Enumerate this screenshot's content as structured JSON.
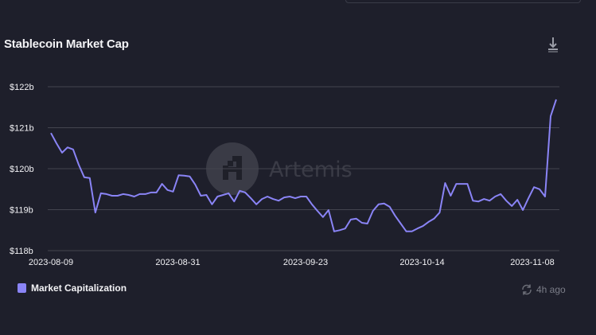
{
  "header": {
    "title": "Stablecoin Market Cap",
    "download_icon": "download-icon"
  },
  "watermark": {
    "text": "Artemis"
  },
  "footer": {
    "updated": "4h ago",
    "refresh_icon": "refresh-icon"
  },
  "colors": {
    "line": "#8a84f6",
    "grid": "#44454f",
    "background": "#1e1f2b"
  },
  "chart_data": {
    "type": "line",
    "title": "Stablecoin Market Cap",
    "xlabel": "",
    "ylabel": "",
    "ylim": [
      118,
      122
    ],
    "yticks": [
      {
        "v": 122,
        "label": "$122b"
      },
      {
        "v": 121,
        "label": "$121b"
      },
      {
        "v": 120,
        "label": "$120b"
      },
      {
        "v": 119,
        "label": "$119b"
      },
      {
        "v": 118,
        "label": "$118b"
      }
    ],
    "x_start": "2023-08-09",
    "x_end": "2023-11-10",
    "xticks": [
      {
        "i": 0,
        "label": "2023-08-09"
      },
      {
        "i": 22,
        "label": "2023-08-31"
      },
      {
        "i": 45,
        "label": "2023-09-23"
      },
      {
        "i": 66,
        "label": "2023-10-14"
      },
      {
        "i": 91,
        "label": "2023-11-08"
      }
    ],
    "grid": true,
    "legend_position": "bottom-left",
    "series": [
      {
        "name": "Market Capitalization",
        "color": "#8a84f6",
        "values": [
          120.87,
          120.62,
          120.39,
          120.52,
          120.47,
          120.1,
          119.79,
          119.77,
          118.93,
          119.4,
          119.38,
          119.34,
          119.34,
          119.38,
          119.36,
          119.32,
          119.38,
          119.38,
          119.42,
          119.42,
          119.63,
          119.48,
          119.44,
          119.84,
          119.83,
          119.81,
          119.61,
          119.34,
          119.36,
          119.13,
          119.32,
          119.36,
          119.4,
          119.2,
          119.46,
          119.42,
          119.28,
          119.13,
          119.26,
          119.32,
          119.26,
          119.22,
          119.3,
          119.32,
          119.28,
          119.32,
          119.32,
          119.13,
          118.97,
          118.82,
          118.99,
          118.47,
          118.5,
          118.54,
          118.76,
          118.78,
          118.68,
          118.66,
          118.97,
          119.13,
          119.15,
          119.07,
          118.85,
          118.66,
          118.47,
          118.47,
          118.54,
          118.6,
          118.7,
          118.78,
          118.93,
          119.65,
          119.34,
          119.63,
          119.63,
          119.63,
          119.22,
          119.2,
          119.26,
          119.22,
          119.32,
          119.38,
          119.22,
          119.09,
          119.24,
          118.99,
          119.28,
          119.55,
          119.5,
          119.32,
          121.28,
          121.69
        ]
      }
    ]
  }
}
